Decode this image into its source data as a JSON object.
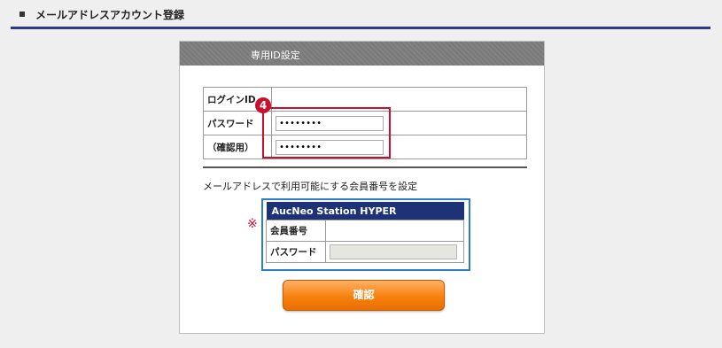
{
  "page": {
    "title": "メールアドレスアカウント登録"
  },
  "panel": {
    "title": "専用ID設定"
  },
  "login": {
    "id_label": "ログインID",
    "password_label": "パスワード",
    "confirm_label": "（確認用）",
    "password_value": "••••••••",
    "confirm_value": "••••••••"
  },
  "step_badge": "4",
  "member_note": "メールアドレスで利用可能にする会員番号を設定",
  "asterisk": "※",
  "aucneo": {
    "header": "AucNeo Station HYPER",
    "member_label": "会員番号",
    "password_label": "パスワード"
  },
  "confirm_button": "確認",
  "colors": {
    "header_rule": "#2b3a8c",
    "highlight_red": "#c8102e",
    "highlight_blue": "#2d7ec9",
    "aucneo_header": "#1e3377",
    "button": "#f7810f"
  }
}
